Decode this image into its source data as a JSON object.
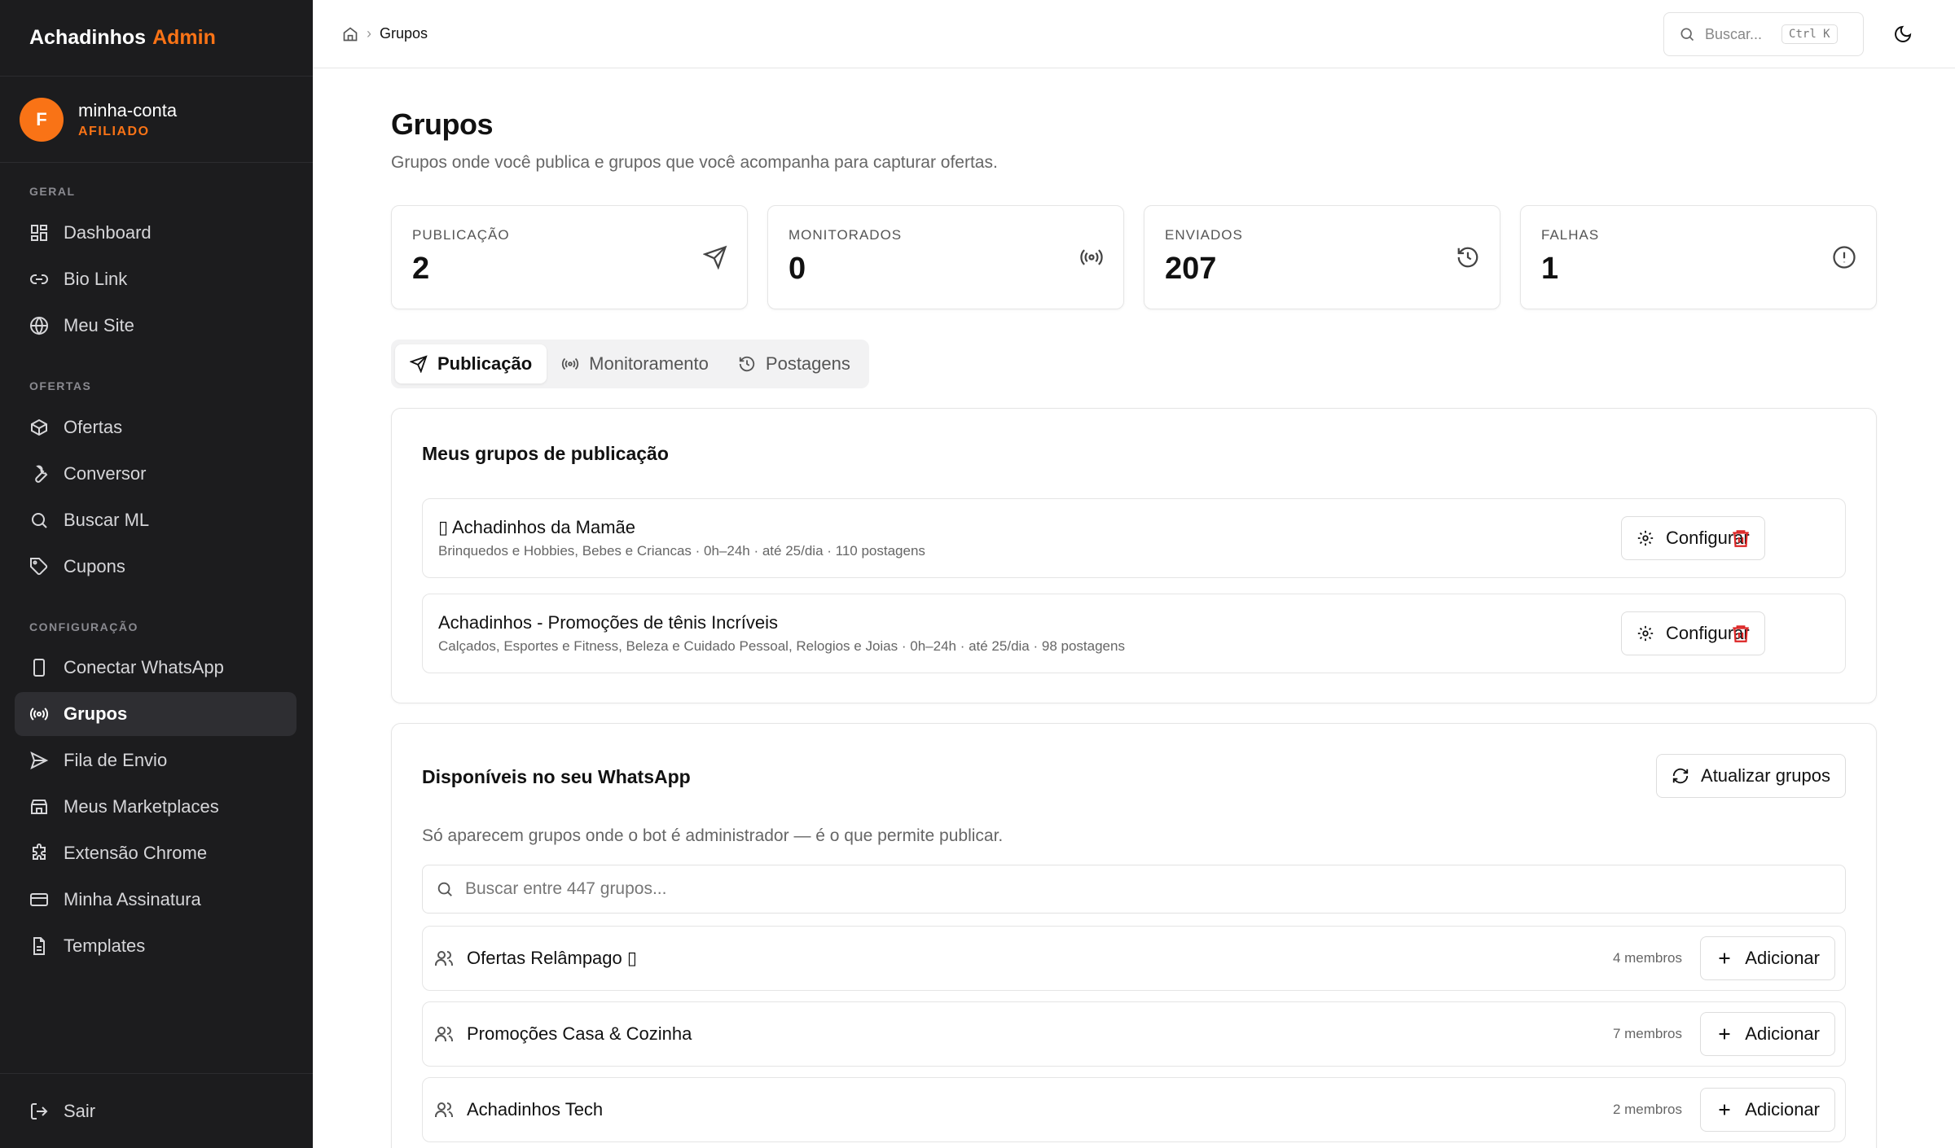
{
  "brand": {
    "name": "Achadinhos",
    "accent": "Admin"
  },
  "account": {
    "initial": "F",
    "name": "minha-conta",
    "role": "AFILIADO"
  },
  "nav": {
    "section_geral": "GERAL",
    "section_ofertas": "OFERTAS",
    "section_config": "CONFIGURAÇÃO",
    "dashboard": "Dashboard",
    "biolink": "Bio Link",
    "meusite": "Meu Site",
    "ofertas": "Ofertas",
    "conversor": "Conversor",
    "buscarml": "Buscar ML",
    "cupons": "Cupons",
    "whatsapp": "Conectar WhatsApp",
    "grupos": "Grupos",
    "fila": "Fila de Envio",
    "marketplaces": "Meus Marketplaces",
    "extensao": "Extensão Chrome",
    "assinatura": "Minha Assinatura",
    "templates": "Templates",
    "sair": "Sair"
  },
  "topbar": {
    "breadcrumb": "Grupos",
    "search_placeholder": "Buscar...",
    "shortcut": "Ctrl K"
  },
  "page": {
    "title": "Grupos",
    "subtitle": "Grupos onde você publica e grupos que você acompanha para capturar ofertas."
  },
  "stats": [
    {
      "label": "PUBLICAÇÃO",
      "value": "2",
      "icon": "send-icon"
    },
    {
      "label": "MONITORADOS",
      "value": "0",
      "icon": "radio-icon"
    },
    {
      "label": "ENVIADOS",
      "value": "207",
      "icon": "history-icon"
    },
    {
      "label": "FALHAS",
      "value": "1",
      "icon": "alert-circle-icon"
    }
  ],
  "tabs": {
    "publicacao": "Publicação",
    "monitoramento": "Monitoramento",
    "postagens": "Postagens"
  },
  "publish_card": {
    "title": "Meus grupos de publicação",
    "configure_label": "Configurar",
    "groups": [
      {
        "name": "▯ Achadinhos da Mamãe",
        "meta": "Brinquedos e Hobbies, Bebes e Criancas · 0h–24h · até 25/dia · 110 postagens"
      },
      {
        "name": "Achadinhos - Promoções de tênis Incríveis",
        "meta": "Calçados, Esportes e Fitness, Beleza e Cuidado Pessoal, Relogios e Joias · 0h–24h · até 25/dia · 98 postagens"
      }
    ]
  },
  "available_card": {
    "title": "Disponíveis no seu WhatsApp",
    "refresh_label": "Atualizar grupos",
    "hint": "Só aparecem grupos onde o bot é administrador — é o que permite publicar.",
    "search_placeholder": "Buscar entre 447 grupos...",
    "add_label": "Adicionar",
    "groups": [
      {
        "name": "Ofertas Relâmpago ▯",
        "members": "4 membros"
      },
      {
        "name": "Promoções Casa & Cozinha",
        "members": "7 membros"
      },
      {
        "name": "Achadinhos Tech",
        "members": "2 membros"
      }
    ]
  },
  "colors": {
    "accent": "#f97316",
    "sidebar_bg": "#1c1c1e",
    "danger": "#dc2626"
  }
}
